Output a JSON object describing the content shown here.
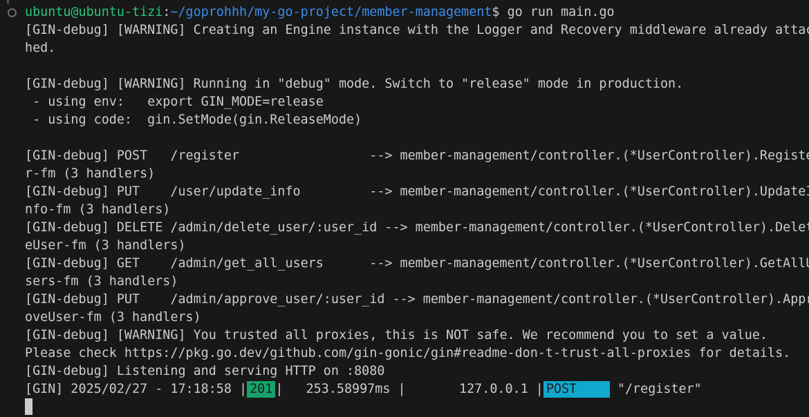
{
  "prompt": {
    "user_host": "ubuntu@ubuntu-tizi",
    "sep": ":",
    "path": "~/goprohhh/my-go-project/member-management",
    "dollar": "$ ",
    "command": "go run main.go"
  },
  "lines": [
    "[GIN-debug] [WARNING] Creating an Engine instance with the Logger and Recovery middleware already attac",
    "hed.",
    "",
    "[GIN-debug] [WARNING] Running in \"debug\" mode. Switch to \"release\" mode in production.",
    " - using env:   export GIN_MODE=release",
    " - using code:  gin.SetMode(gin.ReleaseMode)",
    "",
    "[GIN-debug] POST   /register                 --> member-management/controller.(*UserController).Registe",
    "r-fm (3 handlers)",
    "[GIN-debug] PUT    /user/update_info         --> member-management/controller.(*UserController).UpdateI",
    "nfo-fm (3 handlers)",
    "[GIN-debug] DELETE /admin/delete_user/:user_id --> member-management/controller.(*UserController).Delet",
    "eUser-fm (3 handlers)",
    "[GIN-debug] GET    /admin/get_all_users      --> member-management/controller.(*UserController).GetAllU",
    "sers-fm (3 handlers)",
    "[GIN-debug] PUT    /admin/approve_user/:user_id --> member-management/controller.(*UserController).Appr",
    "oveUser-fm (3 handlers)",
    "[GIN-debug] [WARNING] You trusted all proxies, this is NOT safe. We recommend you to set a value.",
    "Please check https://pkg.go.dev/github.com/gin-gonic/gin#readme-don-t-trust-all-proxies for details.",
    "[GIN-debug] Listening and serving HTTP on :8080"
  ],
  "request_log": {
    "prefix": "[GIN] 2025/02/27 - 17:18:58 |",
    "status": "201",
    "latency": "|   253.58997ms |       127.0.0.1 |",
    "method": "POST",
    "path": " \"/register\""
  },
  "colors": {
    "status_201": "#16a36a",
    "method_post": "#11a8cd",
    "prompt_user": "#2bc47d",
    "prompt_path": "#3b8eea"
  },
  "icons": {
    "command_decoration": "circle-outline-icon"
  }
}
